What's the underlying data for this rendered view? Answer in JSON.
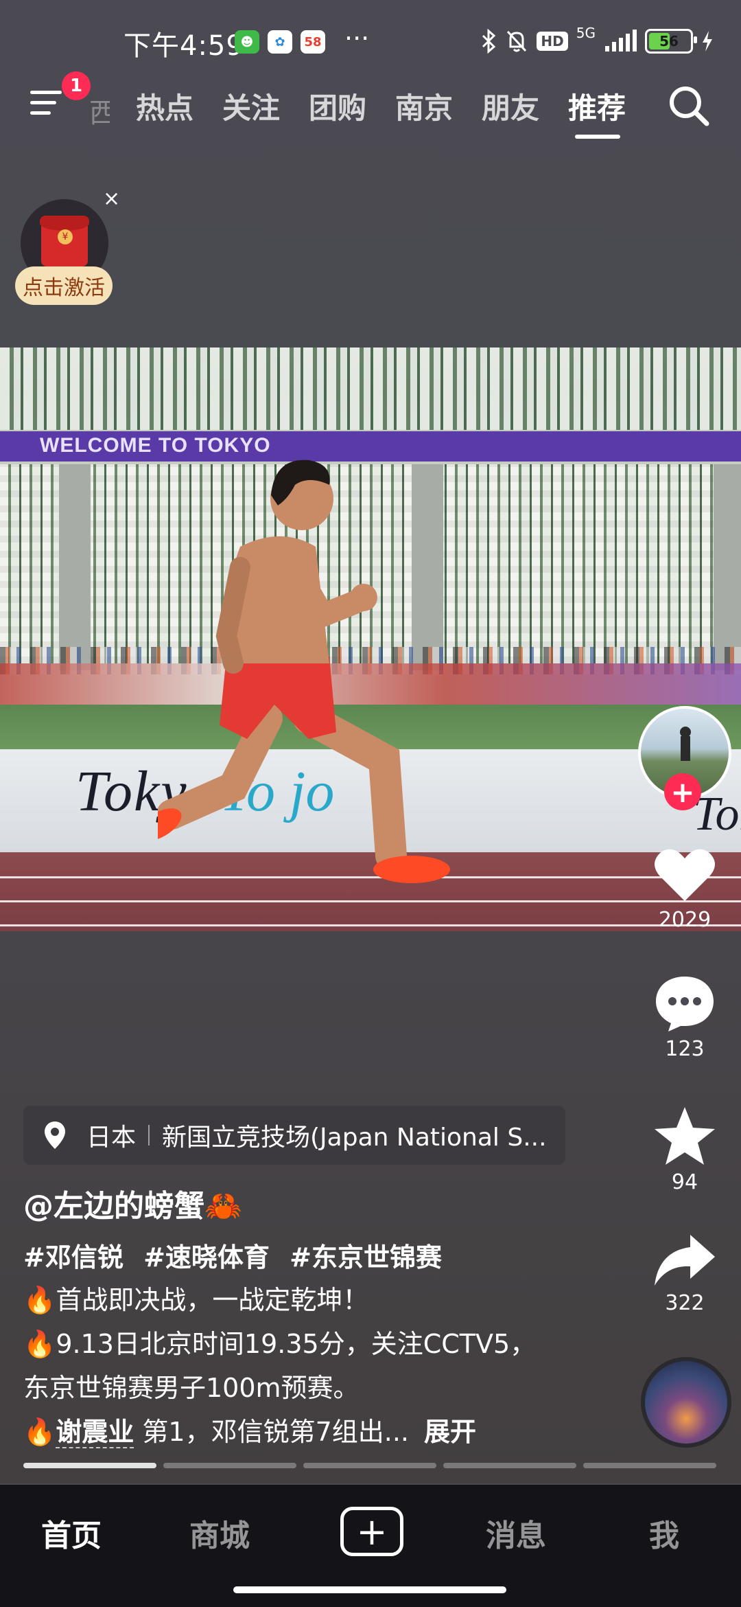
{
  "status_bar": {
    "time": "下午4:59",
    "app_badge_58": "58",
    "more": "···",
    "hd": "HD",
    "network": "5G",
    "battery": "56",
    "battery_level": 0.56
  },
  "top_nav": {
    "menu_badge": "1",
    "faded_tab": "西",
    "tabs": [
      "热点",
      "关注",
      "团购",
      "南京",
      "朋友",
      "推荐"
    ],
    "active_tab": "推荐"
  },
  "red_packet": {
    "coin": "¥",
    "close": "×",
    "label": "点击激活"
  },
  "video": {
    "banner": "WELCOME TO TOKYO",
    "board_left": "Toky",
    "board_mid": "To  jo",
    "board_right": "Tok"
  },
  "actions": {
    "follow": "+",
    "likes": "2029",
    "comments": "123",
    "favorites": "94",
    "shares": "322"
  },
  "location": {
    "country": "日本",
    "place": "新国立竞技场(Japan National S..."
  },
  "post": {
    "author": "@左边的螃蟹🦀",
    "hashtags": [
      "#邓信锐",
      "#速晓体育",
      "#东京世锦赛"
    ],
    "line1": "🔥首战即决战，一战定乾坤！",
    "line2": "🔥9.13日北京时间19.35分，关注CCTV5，",
    "line3": "东京世锦赛男子100m预赛。",
    "line4_prefix": "🔥",
    "line4_link": "谢震业",
    "line4_rest": " 第1，邓信锐第7组出...",
    "expand": "展开"
  },
  "progress": {
    "segments": 5,
    "active": 1
  },
  "bottom_nav": {
    "home": "首页",
    "mall": "商城",
    "plus": "+",
    "messages": "消息",
    "me": "我",
    "active": "首页"
  },
  "colors": {
    "accent": "#fe2c55",
    "background": "#4a4950",
    "bottom_bar": "#141317"
  }
}
